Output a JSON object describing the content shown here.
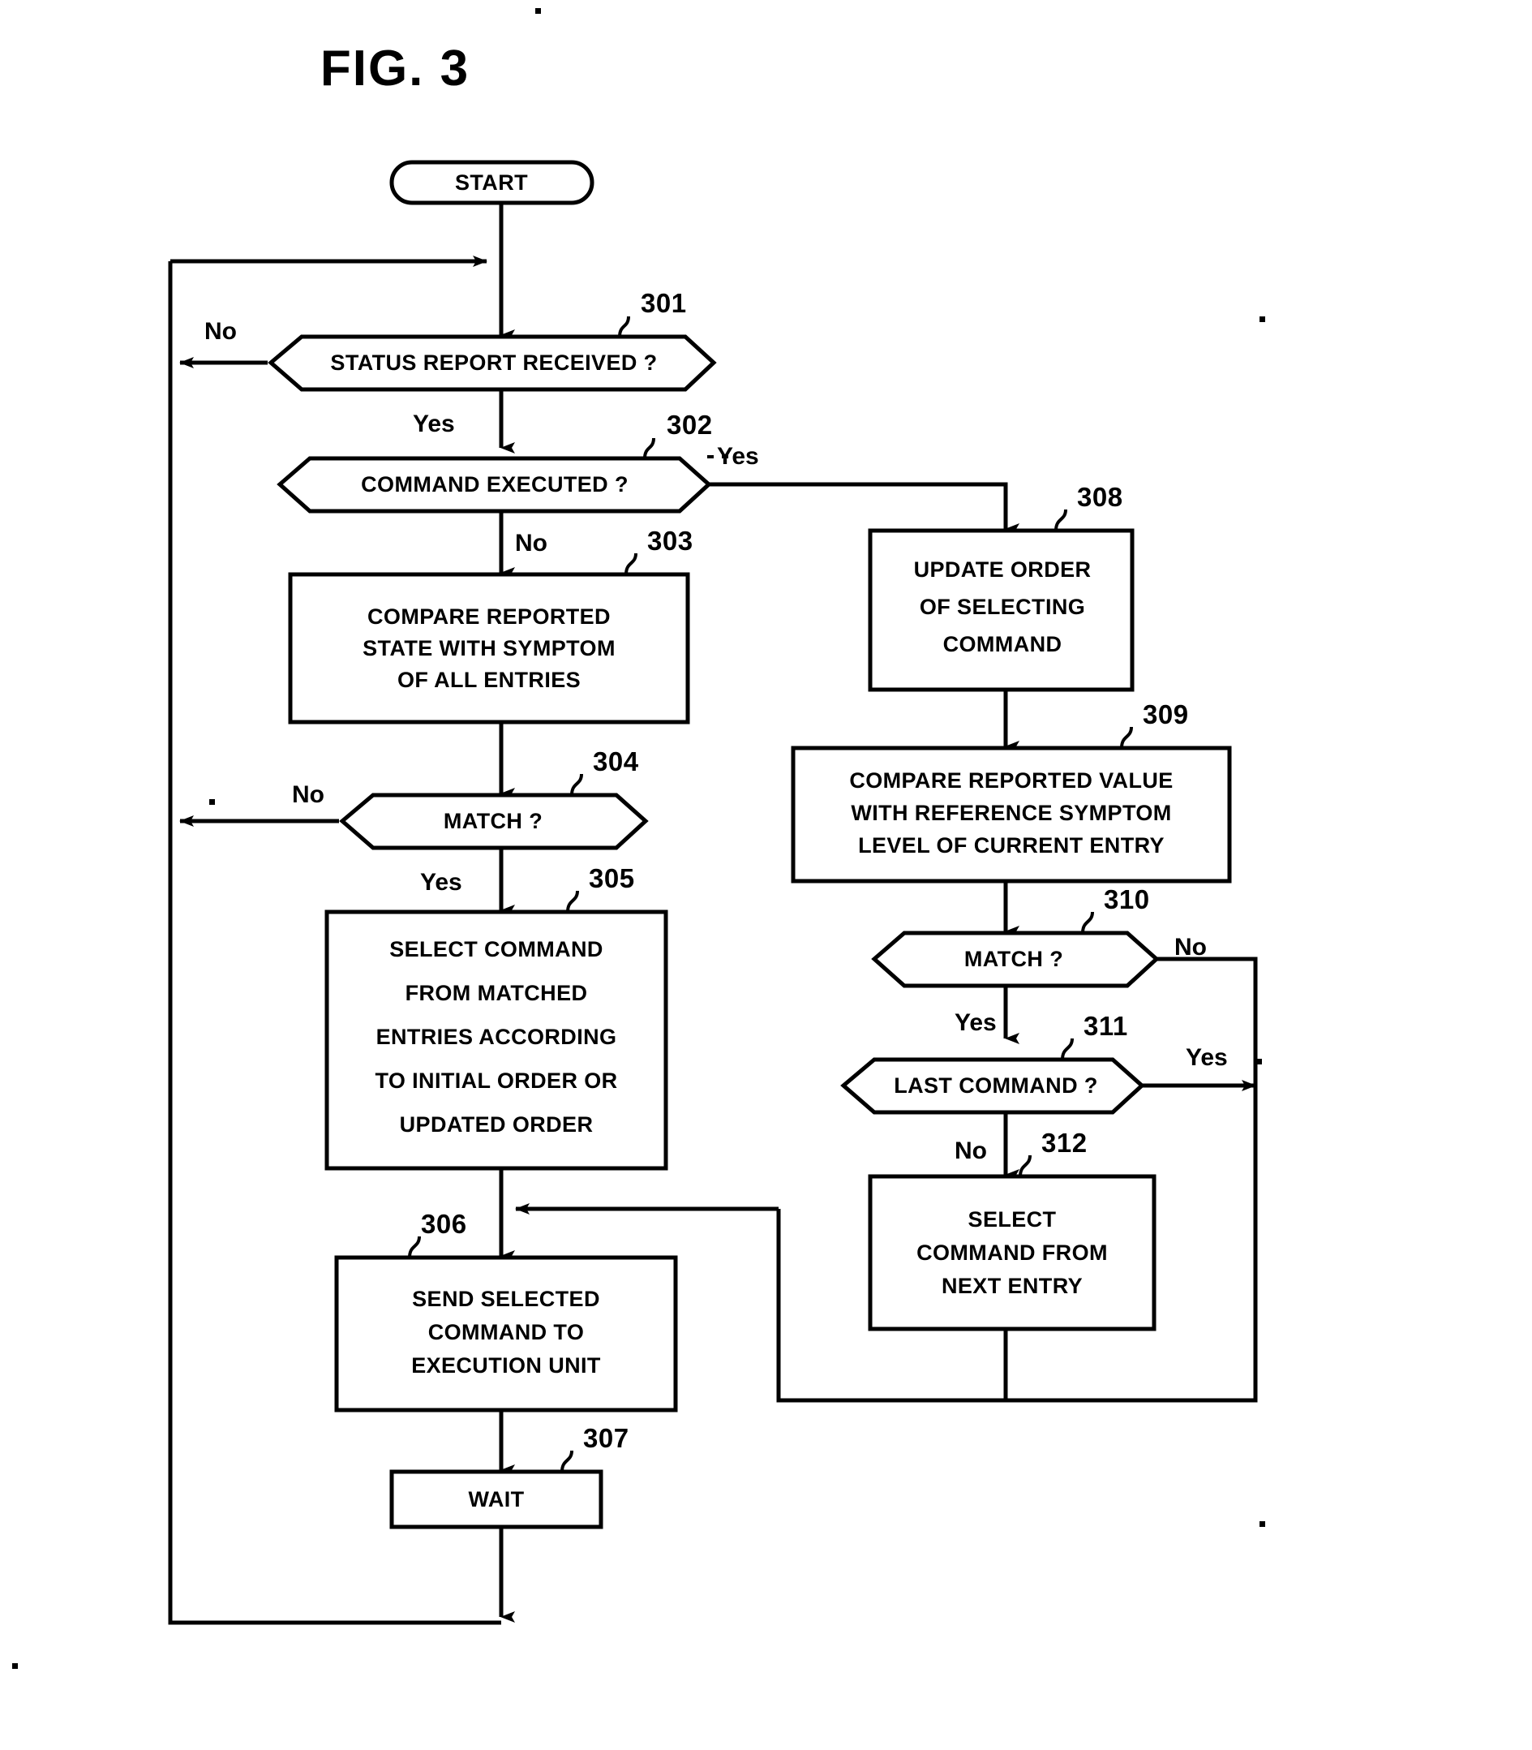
{
  "figure": {
    "title": "FIG. 3",
    "type": "patent-flowchart"
  },
  "nodes": [
    {
      "id": "start",
      "ref": "",
      "shape": "stadium",
      "lines": [
        "START"
      ]
    },
    {
      "id": "n301",
      "ref": "301",
      "shape": "hexagon",
      "lines": [
        "STATUS REPORT RECEIVED ?"
      ]
    },
    {
      "id": "n302",
      "ref": "302",
      "shape": "hexagon",
      "lines": [
        "COMMAND EXECUTED ?"
      ]
    },
    {
      "id": "n303",
      "ref": "303",
      "shape": "rect",
      "lines": [
        "COMPARE REPORTED",
        "STATE WITH SYMPTOM",
        "OF ALL ENTRIES"
      ]
    },
    {
      "id": "n304",
      "ref": "304",
      "shape": "hexagon",
      "lines": [
        "MATCH ?"
      ]
    },
    {
      "id": "n305",
      "ref": "305",
      "shape": "rect",
      "lines": [
        "SELECT COMMAND",
        "FROM MATCHED",
        "ENTRIES ACCORDING",
        "TO INITIAL ORDER OR",
        "UPDATED ORDER"
      ]
    },
    {
      "id": "n306",
      "ref": "306",
      "shape": "rect",
      "lines": [
        "SEND SELECTED",
        "COMMAND TO",
        "EXECUTION UNIT"
      ]
    },
    {
      "id": "n307",
      "ref": "307",
      "shape": "rect",
      "lines": [
        "WAIT"
      ]
    },
    {
      "id": "n308",
      "ref": "308",
      "shape": "rect",
      "lines": [
        "UPDATE ORDER",
        "OF SELECTING",
        "COMMAND"
      ]
    },
    {
      "id": "n309",
      "ref": "309",
      "shape": "rect",
      "lines": [
        "COMPARE REPORTED VALUE",
        "WITH REFERENCE SYMPTOM",
        "LEVEL OF CURRENT ENTRY"
      ]
    },
    {
      "id": "n310",
      "ref": "310",
      "shape": "hexagon",
      "lines": [
        "MATCH ?"
      ]
    },
    {
      "id": "n311",
      "ref": "311",
      "shape": "hexagon",
      "lines": [
        "LAST COMMAND ?"
      ]
    },
    {
      "id": "n312",
      "ref": "312",
      "shape": "rect",
      "lines": [
        "SELECT",
        "COMMAND FROM",
        "NEXT ENTRY"
      ]
    }
  ],
  "edge_labels": {
    "n301_no": "No",
    "n301_yes": "Yes",
    "n302_yes": "Yes",
    "n302_no": "No",
    "n304_no": "No",
    "n304_yes": "Yes",
    "n310_no": "No",
    "n310_yes": "Yes",
    "n311_yes": "Yes",
    "n311_no": "No"
  },
  "ref_labels": {
    "r301": "301",
    "r302": "302",
    "r303": "303",
    "r304": "304",
    "r305": "305",
    "r306": "306",
    "r307": "307",
    "r308": "308",
    "r309": "309",
    "r310": "310",
    "r311": "311",
    "r312": "312"
  },
  "colors": {
    "ink": "#000000",
    "paper": "#ffffff"
  }
}
